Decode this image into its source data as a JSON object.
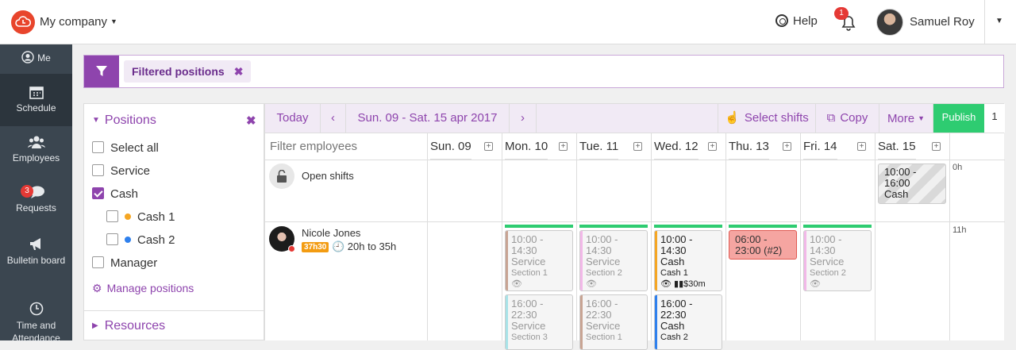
{
  "topbar": {
    "company": "My company",
    "help": "Help",
    "notifications_count": "1",
    "username": "Samuel Roy"
  },
  "nav": [
    {
      "label": "Me",
      "icon": "user-icon"
    },
    {
      "label": "Schedule",
      "icon": "calendar-icon"
    },
    {
      "label": "Employees",
      "icon": "people-icon"
    },
    {
      "label": "Requests",
      "icon": "chat-icon",
      "badge": "3"
    },
    {
      "label": "Bulletin board",
      "icon": "megaphone-icon"
    },
    {
      "label": "Time and Attendance",
      "icon": "clock-icon"
    }
  ],
  "filter": {
    "chip": "Filtered positions",
    "chip_close": "✖"
  },
  "positions_panel": {
    "title": "Positions",
    "close": "✖",
    "items": [
      {
        "label": "Select all",
        "checked": false
      },
      {
        "label": "Service",
        "checked": false
      },
      {
        "label": "Cash",
        "checked": true
      },
      {
        "label": "Cash 1",
        "checked": false,
        "color": "#f5a623"
      },
      {
        "label": "Cash 2",
        "checked": false,
        "color": "#2f80ed"
      },
      {
        "label": "Manager",
        "checked": false
      }
    ],
    "manage": "Manage positions",
    "resources": "Resources"
  },
  "toolbar": {
    "today": "Today",
    "prev": "‹",
    "range": "Sun. 09 - Sat. 15 apr 2017",
    "next": "›",
    "select_shifts": "Select shifts",
    "copy": "Copy",
    "more": "More",
    "publish": "Publish",
    "publish_count": "1"
  },
  "grid": {
    "filter_placeholder": "Filter employees",
    "days": [
      "Sun. 09",
      "Mon. 10",
      "Tue. 11",
      "Wed. 12",
      "Thu. 13",
      "Fri. 14",
      "Sat. 15"
    ],
    "open_shifts_label": "Open shifts",
    "open_hours": "0h",
    "employee": {
      "name": "Nicole Jones",
      "badge": "37h30",
      "range": "20h to 35h",
      "hours": "11h"
    },
    "open_shift_sat": {
      "time1": "10:00 -",
      "time2": "16:00",
      "position": "Cash"
    },
    "shifts": {
      "mon_a": {
        "time1": "10:00 -",
        "time2": "14:30",
        "position": "Service",
        "section": "Section 1",
        "extra": "👁"
      },
      "mon_b": {
        "time1": "16:00 -",
        "time2": "22:30",
        "position": "Service",
        "section": "Section 3"
      },
      "tue_a": {
        "time1": "10:00 -",
        "time2": "14:30",
        "position": "Service",
        "section": "Section 2",
        "extra": "👁"
      },
      "tue_b": {
        "time1": "16:00 -",
        "time2": "22:30",
        "position": "Service",
        "section": "Section 1"
      },
      "wed_a": {
        "time1": "10:00 -",
        "time2": "14:30",
        "position": "Cash",
        "section": "Cash 1",
        "extra": "👁 ▮▮$30m"
      },
      "wed_b": {
        "time1": "16:00 -",
        "time2": "22:30",
        "position": "Cash",
        "section": "Cash 2"
      },
      "thu_a": {
        "time1": "06:00 -",
        "time2": "23:00 (#2)"
      },
      "fri_a": {
        "time1": "10:00 -",
        "time2": "14:30",
        "position": "Service",
        "section": "Section 2",
        "extra": "👁"
      }
    }
  }
}
